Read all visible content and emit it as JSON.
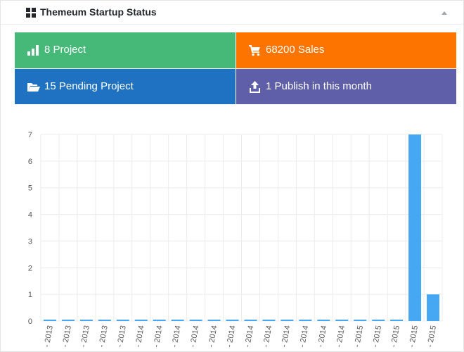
{
  "widget": {
    "title": "Themeum Startup Status",
    "title_icon": "dashboard-grid-icon",
    "collapse_icon": "triangle-up-icon"
  },
  "stats": {
    "projects": {
      "label": "8 Project",
      "icon": "bar-chart-icon",
      "color": "#46b979"
    },
    "sales": {
      "label": "68200 Sales",
      "icon": "cart-icon",
      "color": "#fd7400"
    },
    "pending": {
      "label": "15 Pending Project",
      "icon": "folder-open-icon",
      "color": "#1e72c1"
    },
    "publish": {
      "label": "1 Publish in this month",
      "icon": "upload-icon",
      "color": "#5f5fa9"
    }
  },
  "chart_data": {
    "type": "bar",
    "categories": [
      "2013",
      "2013",
      "2013",
      "2013",
      "2013",
      "2014",
      "2014",
      "2014",
      "2014",
      "2014",
      "2014",
      "2014",
      "2014",
      "2014",
      "2014",
      "2014",
      "2014",
      "2015",
      "2015",
      "2015",
      "2015",
      "2015"
    ],
    "categories_note_visible": "- 2013",
    "values": [
      0,
      0,
      0,
      0,
      0,
      0,
      0,
      0,
      0,
      0,
      0,
      0,
      0,
      0,
      0,
      0,
      0,
      0,
      0,
      0,
      7,
      1
    ],
    "ylim": [
      0,
      7
    ],
    "yticks": [
      0,
      1,
      2,
      3,
      4,
      5,
      6,
      7
    ],
    "grid": true,
    "bar_color": "#46a7f3",
    "title": "",
    "xlabel": "",
    "ylabel": ""
  }
}
